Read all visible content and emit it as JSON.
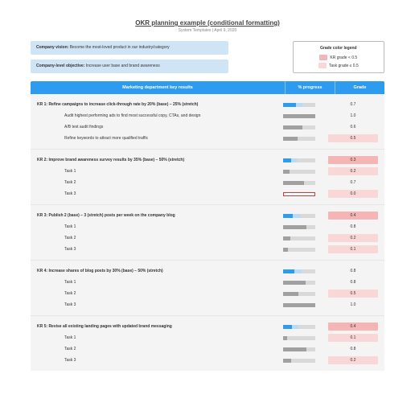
{
  "header": {
    "title": "OKR planning example (conditional formatting)",
    "subtitle": "System Templates  |  April 9, 2020"
  },
  "vision": {
    "vision_label": "Company vision:",
    "vision_text": "Become the most-loved product in our industry/category",
    "objective_label": "Company-level objective:",
    "objective_text": "Increase user base and brand awareness"
  },
  "legend": {
    "title": "Grade color legend",
    "kr": "KR grade < 0.5",
    "task": "Task grade ≤ 0.5"
  },
  "columns": {
    "kr": "Marketing department key results",
    "progress": "% progress",
    "grade": "Grade"
  },
  "krs": [
    {
      "label": "KR 1: Refine campaigns to increase click-through rate by 20% (base) – 25% (stretch)",
      "base": 40,
      "stretch": 20,
      "grade": "0.7",
      "grade_class": "",
      "tasks": [
        {
          "label": "Audit highest performing ads to find most successful copy, CTAs, and design",
          "prog": 100,
          "grade": "1.0",
          "grade_class": ""
        },
        {
          "label": "A/B test audit findings",
          "prog": 60,
          "grade": "0.6",
          "grade_class": ""
        },
        {
          "label": "Refine keywords to attract more qualified traffic",
          "prog": 45,
          "grade": "0.5",
          "grade_class": "bad-task"
        }
      ]
    },
    {
      "label": "KR 2: Improve brand awareness survey results by 35% (base) – 50% (stretch)",
      "base": 25,
      "stretch": 18,
      "grade": "0.3",
      "grade_class": "bad-kr",
      "tasks": [
        {
          "label": "Task 1",
          "prog": 20,
          "grade": "0.2",
          "grade_class": "bad-task"
        },
        {
          "label": "Task 2",
          "prog": 65,
          "grade": "0.7",
          "grade_class": ""
        },
        {
          "label": "Task 3",
          "prog": -1,
          "grade": "0.0",
          "grade_class": "bad-task"
        }
      ]
    },
    {
      "label": "KR 3: Publish 2 (base) – 3 (stretch) posts per week on the company blog",
      "base": 30,
      "stretch": 25,
      "grade": "0.4",
      "grade_class": "bad-kr",
      "tasks": [
        {
          "label": "Task 1",
          "prog": 72,
          "grade": "0.8",
          "grade_class": ""
        },
        {
          "label": "Task 2",
          "prog": 22,
          "grade": "0.2",
          "grade_class": "bad-task"
        },
        {
          "label": "Task 3",
          "prog": 15,
          "grade": "0.1",
          "grade_class": "bad-task"
        }
      ]
    },
    {
      "label": "KR 4: Increase shares of blog posts by 30% (base) – 50% (stretch)",
      "base": 35,
      "stretch": 22,
      "grade": "0.8",
      "grade_class": "",
      "tasks": [
        {
          "label": "Task 1",
          "prog": 70,
          "grade": "0.8",
          "grade_class": ""
        },
        {
          "label": "Task 2",
          "prog": 48,
          "grade": "0.5",
          "grade_class": "bad-task"
        },
        {
          "label": "Task 3",
          "prog": 100,
          "grade": "1.0",
          "grade_class": ""
        }
      ]
    },
    {
      "label": "KR 5: Revise all existing landing pages with updated brand messaging",
      "base": 28,
      "stretch": 20,
      "grade": "0.4",
      "grade_class": "bad-kr",
      "tasks": [
        {
          "label": "Task 1",
          "prog": 12,
          "grade": "0.1",
          "grade_class": "bad-task"
        },
        {
          "label": "Task 2",
          "prog": 72,
          "grade": "0.8",
          "grade_class": ""
        },
        {
          "label": "Task 3",
          "prog": 25,
          "grade": "0.2",
          "grade_class": "bad-task"
        }
      ]
    }
  ]
}
